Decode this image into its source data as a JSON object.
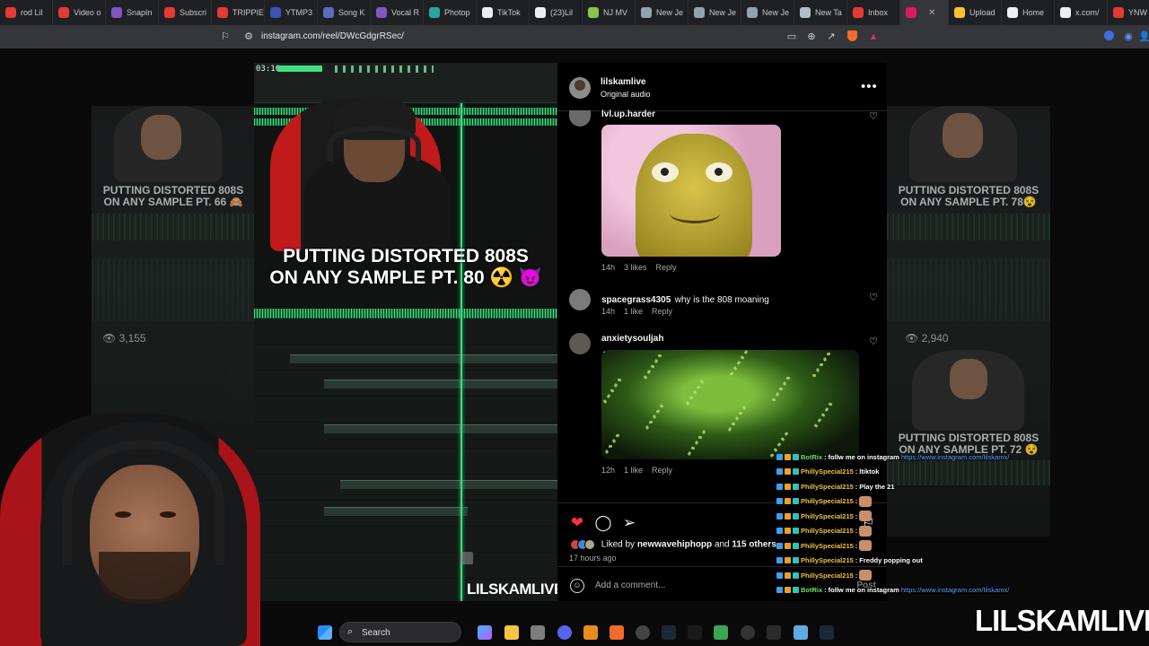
{
  "browser": {
    "tabs": [
      {
        "label": "rod Lil",
        "color": "#e53935"
      },
      {
        "label": "Video o",
        "color": "#e53935"
      },
      {
        "label": "SnapIn",
        "color": "#7e57c2"
      },
      {
        "label": "Subscri",
        "color": "#e53935"
      },
      {
        "label": "TRIPPIE",
        "color": "#e53935"
      },
      {
        "label": "YTMP3",
        "color": "#3f51b5"
      },
      {
        "label": "Song K",
        "color": "#5c6bc0"
      },
      {
        "label": "Vocal R",
        "color": "#7e57c2"
      },
      {
        "label": "Photop",
        "color": "#26a69a"
      },
      {
        "label": "TikTok",
        "color": "#eeeeee"
      },
      {
        "label": "(23)Lil",
        "color": "#eeeeee"
      },
      {
        "label": "NJ MV",
        "color": "#8bc34a"
      },
      {
        "label": "New Je",
        "color": "#90a4ae"
      },
      {
        "label": "New Je",
        "color": "#90a4ae"
      },
      {
        "label": "New Je",
        "color": "#90a4ae"
      },
      {
        "label": "New Ta",
        "color": "#b0bec5"
      },
      {
        "label": "Inbox",
        "color": "#e53935"
      },
      {
        "label": "",
        "color": "#d81b60",
        "active": true
      },
      {
        "label": "Upload",
        "color": "#fbc02d"
      },
      {
        "label": "Home",
        "color": "#eeeeee"
      },
      {
        "label": "x.com/",
        "color": "#eeeeee"
      },
      {
        "label": "YNW",
        "color": "#e53935"
      }
    ],
    "url": "instagram.com/reel/DWcGdgrRSec/"
  },
  "video": {
    "time": "03:16",
    "title_line1": "PUTTING DISTORTED 808S",
    "title_line2": "ON ANY SAMPLE PT. 80 ☢️ 😈",
    "watermark": "LILSKAMLIVE"
  },
  "left_reel": {
    "caption_line1": "PUTTING DISTORTED 808S",
    "caption_line2": "ON ANY SAMPLE PT. 66 🙈",
    "views": "3,155"
  },
  "right_reel_top": {
    "caption_line1": "PUTTING DISTORTED 808S",
    "caption_line2": "ON ANY SAMPLE PT. 78😵",
    "views": "2,940"
  },
  "right_reel_bottom": {
    "caption_line1": "PUTTING DISTORTED 808S",
    "caption_line2": "ON ANY SAMPLE PT. 72 😵"
  },
  "post": {
    "username": "lilskamlive",
    "audio": "Original audio",
    "comments": [
      {
        "user": "lvl.up.harder",
        "text": "",
        "time": "14h",
        "likes": "3 likes",
        "reply": "Reply"
      },
      {
        "user": "spacegrass4305",
        "text": "why is the 808 moaning",
        "time": "14h",
        "likes": "1 like",
        "reply": "Reply"
      },
      {
        "user": "anxietysouljah",
        "text": "",
        "time": "12h",
        "likes": "1 like",
        "reply": "Reply"
      }
    ],
    "liked_prefix": "Liked by",
    "liked_user": "newwavehiphopp",
    "liked_and": "and",
    "liked_others": "115 others",
    "time_ago": "17 hours ago",
    "comment_placeholder": "Add a comment...",
    "post_label": "Post"
  },
  "chat": [
    {
      "user": "BotRix",
      "color": "#6ee06e",
      "text": "follw me on instagram",
      "link": "https://www.instagram.com/lilskamx/"
    },
    {
      "user": "PhillySpecial215",
      "color": "#f0c040",
      "text": "ltiktok",
      "link": ""
    },
    {
      "user": "PhillySpecial215",
      "color": "#f0c040",
      "text": "Play the 21",
      "link": ""
    },
    {
      "user": "PhillySpecial215",
      "color": "#f0c040",
      "text": "",
      "link": ""
    },
    {
      "user": "PhillySpecial215",
      "color": "#f0c040",
      "text": "",
      "link": ""
    },
    {
      "user": "PhillySpecial215",
      "color": "#f0c040",
      "text": "",
      "link": ""
    },
    {
      "user": "PhillySpecial215",
      "color": "#f0c040",
      "text": "",
      "link": ""
    },
    {
      "user": "PhillySpecial215",
      "color": "#f0c040",
      "text": "Freddy popping out",
      "link": ""
    },
    {
      "user": "PhillySpecial215",
      "color": "#f0c040",
      "text": "",
      "link": ""
    },
    {
      "user": "BotRix",
      "color": "#6ee06e",
      "text": "follw me on instagram",
      "link": "https://www.instagram.com/lilskamx/"
    }
  ],
  "stream_brand": "LILSKAMLIVE",
  "taskbar": {
    "search_label": "Search"
  },
  "colors": {
    "like_red": "#ff3040",
    "bg": "#000000",
    "accent_green": "#35e07a"
  }
}
